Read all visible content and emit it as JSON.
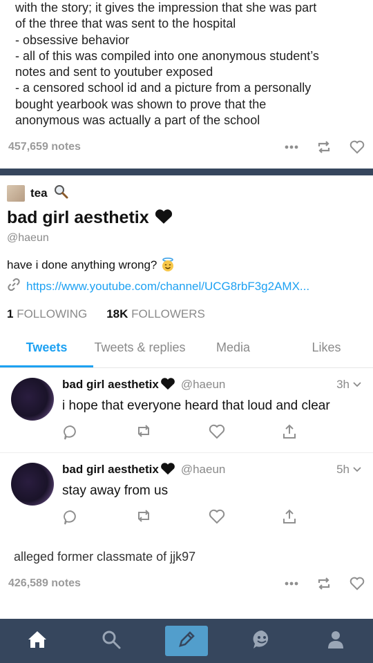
{
  "post": {
    "lines": [
      "with the story; it gives the impression that she was part",
      "of the three that was sent to the hospital",
      "- obsessive behavior",
      "- all of this was compiled into one anonymous student’s",
      "notes and sent to youtuber exposed",
      "- a censored school id and a picture from a personally",
      "bought yearbook was shown to prove that the",
      "anonymous was actually a part of the school"
    ],
    "notes": "457,659 notes"
  },
  "profile": {
    "blog_name": "tea",
    "display_name": "bad girl aesthetix",
    "handle": "@haeun",
    "bio": "have i done anything wrong?",
    "link": "https://www.youtube.com/channel/UCG8rbF3g2AMX...",
    "following_count": "1",
    "following_label": "FOLLOWING",
    "followers_count": "18K",
    "followers_label": "FOLLOWERS"
  },
  "tabs": [
    {
      "label": "Tweets",
      "active": true
    },
    {
      "label": "Tweets & replies"
    },
    {
      "label": "Media"
    },
    {
      "label": "Likes"
    }
  ],
  "tweets": [
    {
      "name": "bad girl aesthetix",
      "handle": "@haeun",
      "time": "3h",
      "text": "i hope that everyone heard that loud and clear"
    },
    {
      "name": "bad girl aesthetix",
      "handle": "@haeun",
      "time": "5h",
      "text": "stay away from us"
    }
  ],
  "caption": "alleged former classmate of jjk97",
  "notes2": "426,589 notes",
  "colors": {
    "accent": "#1da1f2",
    "nav": "#36465d",
    "compose": "#529ecc"
  },
  "icons": [
    "share-dots-icon",
    "reblog-icon",
    "heart-icon",
    "home-icon",
    "search-icon",
    "pencil-icon",
    "smiley-icon",
    "person-icon"
  ]
}
